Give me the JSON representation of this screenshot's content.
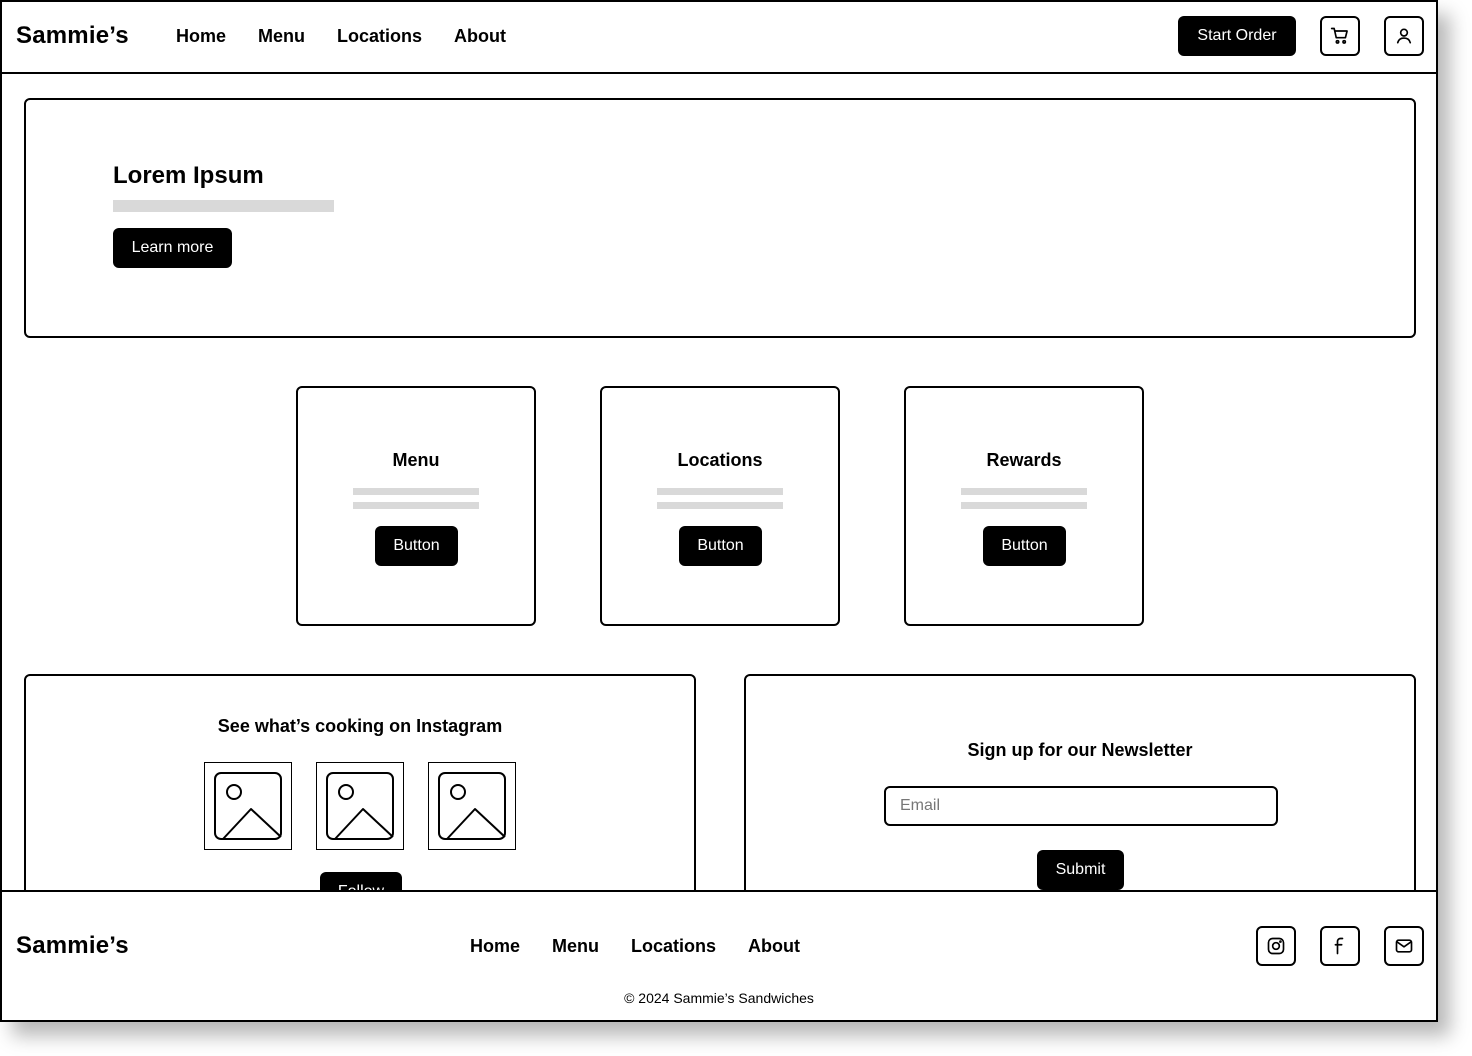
{
  "header": {
    "logo": "Sammie’s",
    "nav": [
      "Home",
      "Menu",
      "Locations",
      "About"
    ],
    "start_order": "Start Order",
    "cart_icon": "cart-icon",
    "account_icon": "user-icon"
  },
  "hero": {
    "title": "Lorem Ipsum",
    "button": "Learn more"
  },
  "cards": [
    {
      "title": "Menu",
      "button": "Button"
    },
    {
      "title": "Locations",
      "button": "Button"
    },
    {
      "title": "Rewards",
      "button": "Button"
    }
  ],
  "instagram": {
    "title": "See what’s cooking on Instagram",
    "follow": "Follow"
  },
  "newsletter": {
    "title": "Sign up for our Newsletter",
    "email_placeholder": "Email",
    "submit": "Submit"
  },
  "footer": {
    "logo": "Sammie’s",
    "nav": [
      "Home",
      "Menu",
      "Locations",
      "About"
    ],
    "social_icons": [
      "instagram-icon",
      "facebook-icon",
      "mail-icon"
    ],
    "copyright": "© 2024 Sammie’s Sandwiches"
  }
}
